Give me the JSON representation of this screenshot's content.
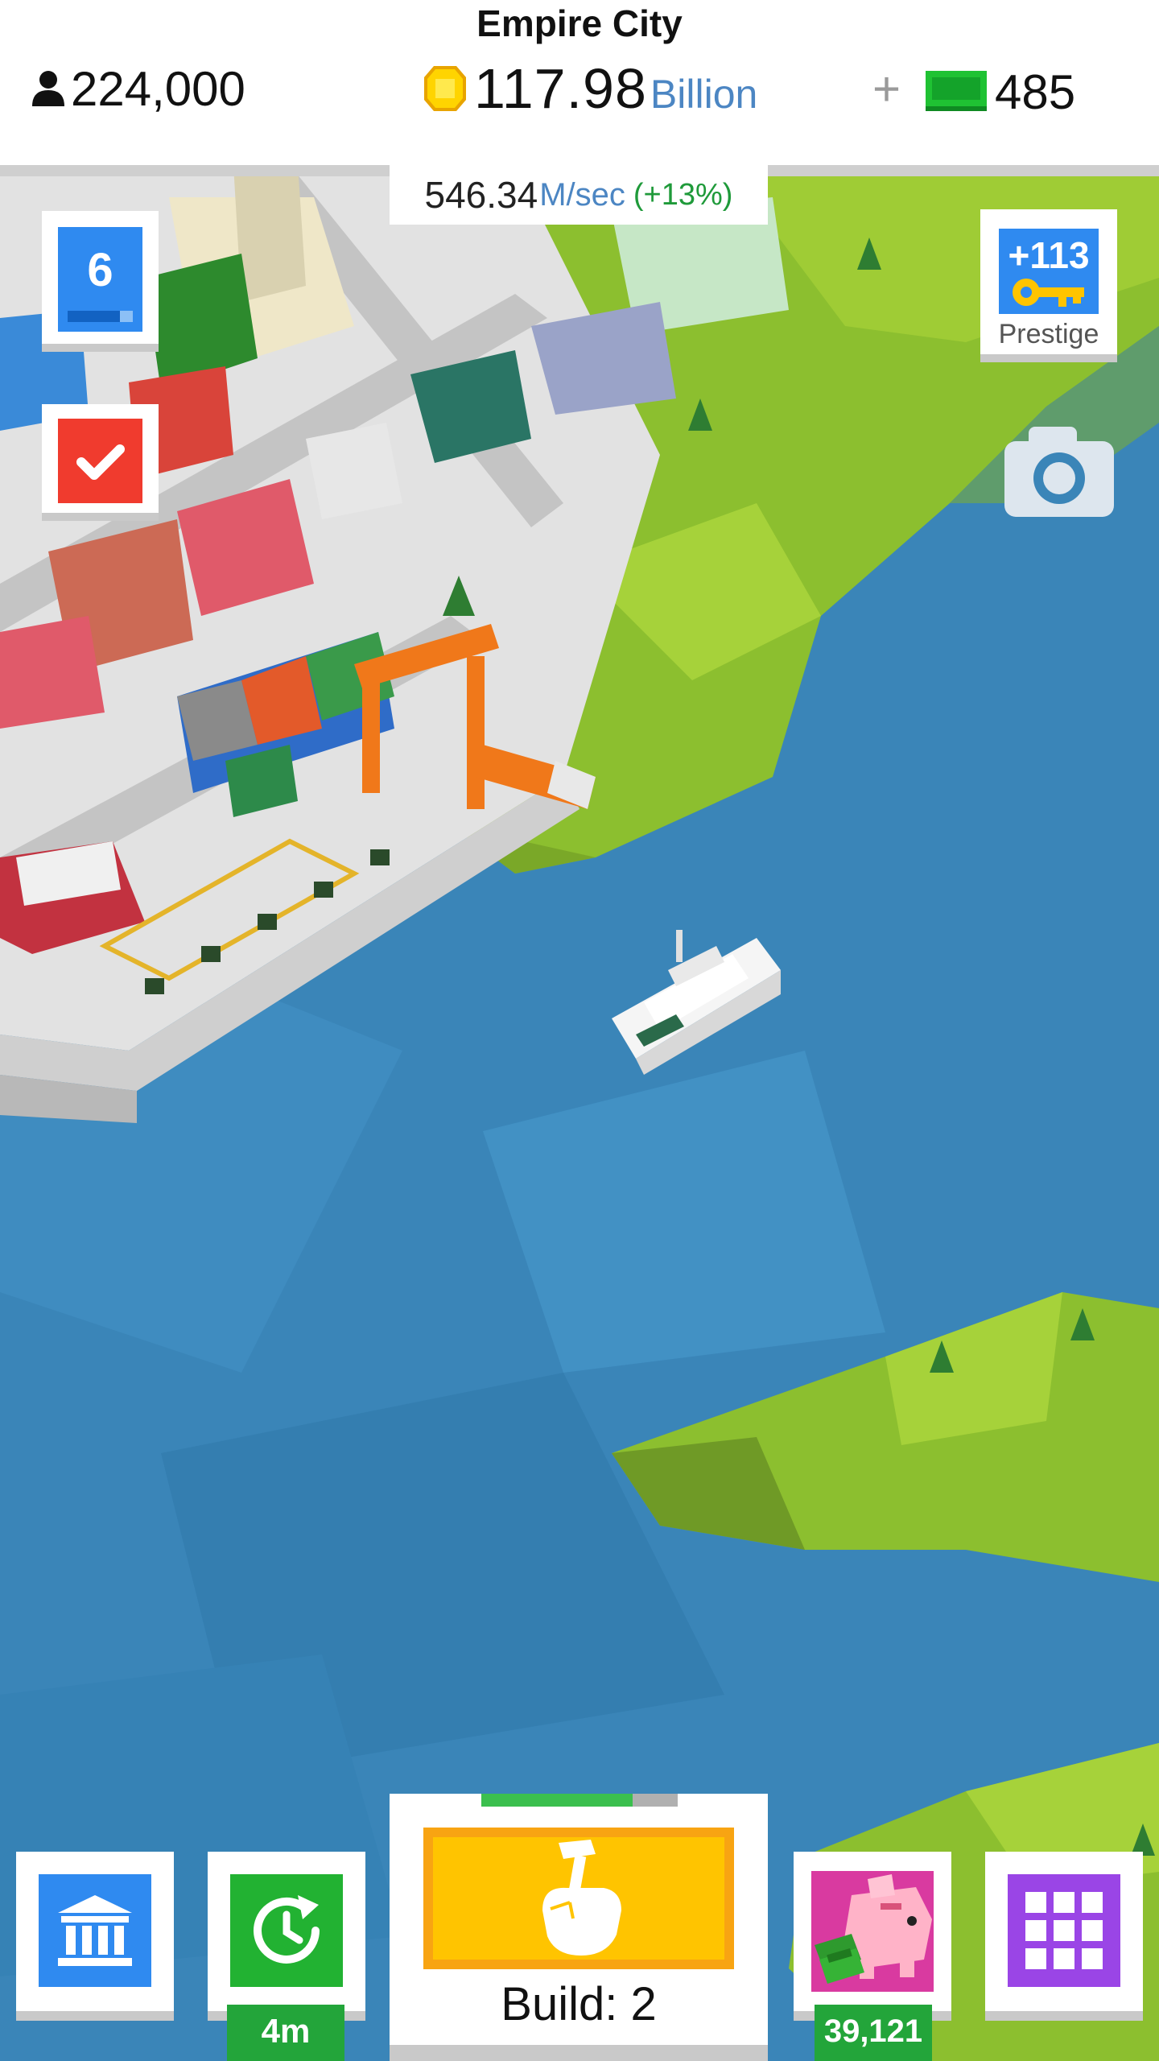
{
  "header": {
    "city_name": "Empire City",
    "population": "224,000",
    "coins_value": "117.98",
    "coins_unit": "Billion",
    "plus": "+",
    "cash": "485"
  },
  "income": {
    "value": "546.34",
    "unit": "M/sec",
    "bonus": "(+13%)"
  },
  "level": {
    "number": "6",
    "progress": 0.8
  },
  "prestige": {
    "keys": "+113",
    "label": "Prestige"
  },
  "bottom_bar": {
    "boost_timer": "4m",
    "build_label": "Build: 2",
    "build_progress": 0.77,
    "piggy_bank": "39,121"
  },
  "icons": {
    "population": "person-icon",
    "coins": "coin-icon",
    "cash": "cash-icon",
    "task": "checkmark-icon",
    "camera": "camera-icon",
    "bank": "bank-icon",
    "boost": "clock-refresh-icon",
    "build": "hammer-hand-icon",
    "piggy": "piggy-bank-icon",
    "menu": "grid-icon"
  },
  "colors": {
    "water": "#3a85b8",
    "grass": "#8cbf2f",
    "accent_blue": "#2f8af0",
    "accent_green": "#22b232",
    "build_yellow": "#ffc400",
    "menu_purple": "#9a45e6",
    "task_red": "#f03b2e"
  }
}
